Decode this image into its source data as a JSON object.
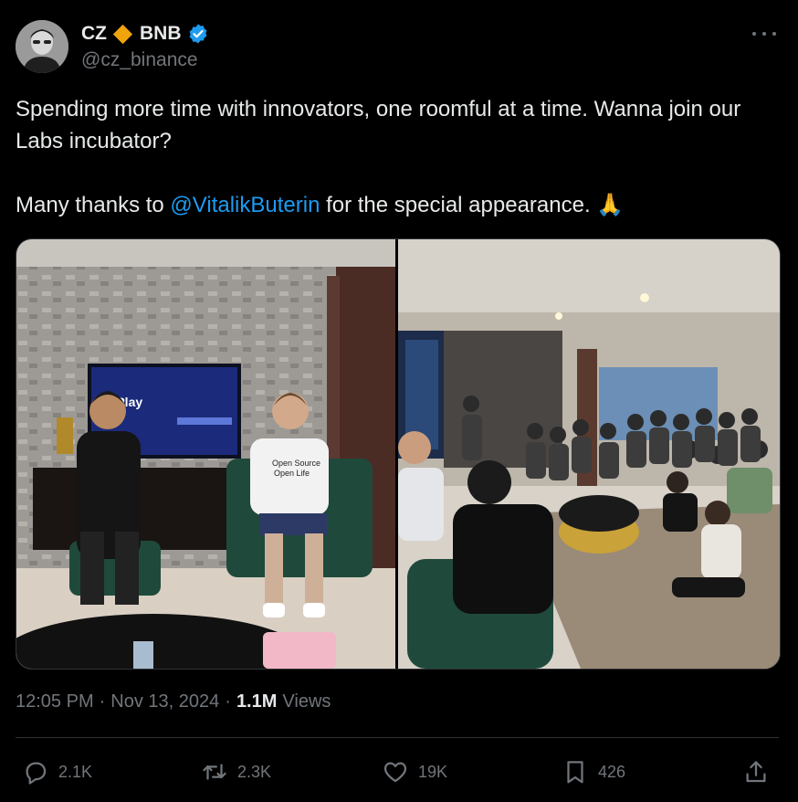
{
  "author": {
    "name": "CZ",
    "name_suffix": "BNB",
    "handle": "@cz_binance",
    "verified": true,
    "diamond_color": "#f0a40b",
    "verified_color": "#1d9bf0"
  },
  "tweet": {
    "line1": "Spending more time with innovators, one roomful at a time. Wanna join our Labs incubator?",
    "line2_prefix": "Many thanks to ",
    "mention": "@VitalikButerin",
    "line2_suffix": " for the special appearance. ",
    "emoji": "🙏"
  },
  "media": {
    "left_photo_icon": "photo-two-people-icon",
    "right_photo_icon": "photo-group-room-icon",
    "left_photo_tv_text": "irPlay",
    "left_photo_shirt_text_1": "Open Source",
    "left_photo_shirt_text_2": "Open Life"
  },
  "meta": {
    "time": "12:05 PM",
    "sep1": "·",
    "date": "Nov 13, 2024",
    "sep2": "·",
    "views_count": "1.1M",
    "views_label": "Views"
  },
  "actions": {
    "reply_count": "2.1K",
    "repost_count": "2.3K",
    "like_count": "19K",
    "bookmark_count": "426"
  },
  "colors": {
    "background": "#000000",
    "text": "#e7e9ea",
    "muted": "#71767b",
    "accent": "#1d9bf0"
  }
}
